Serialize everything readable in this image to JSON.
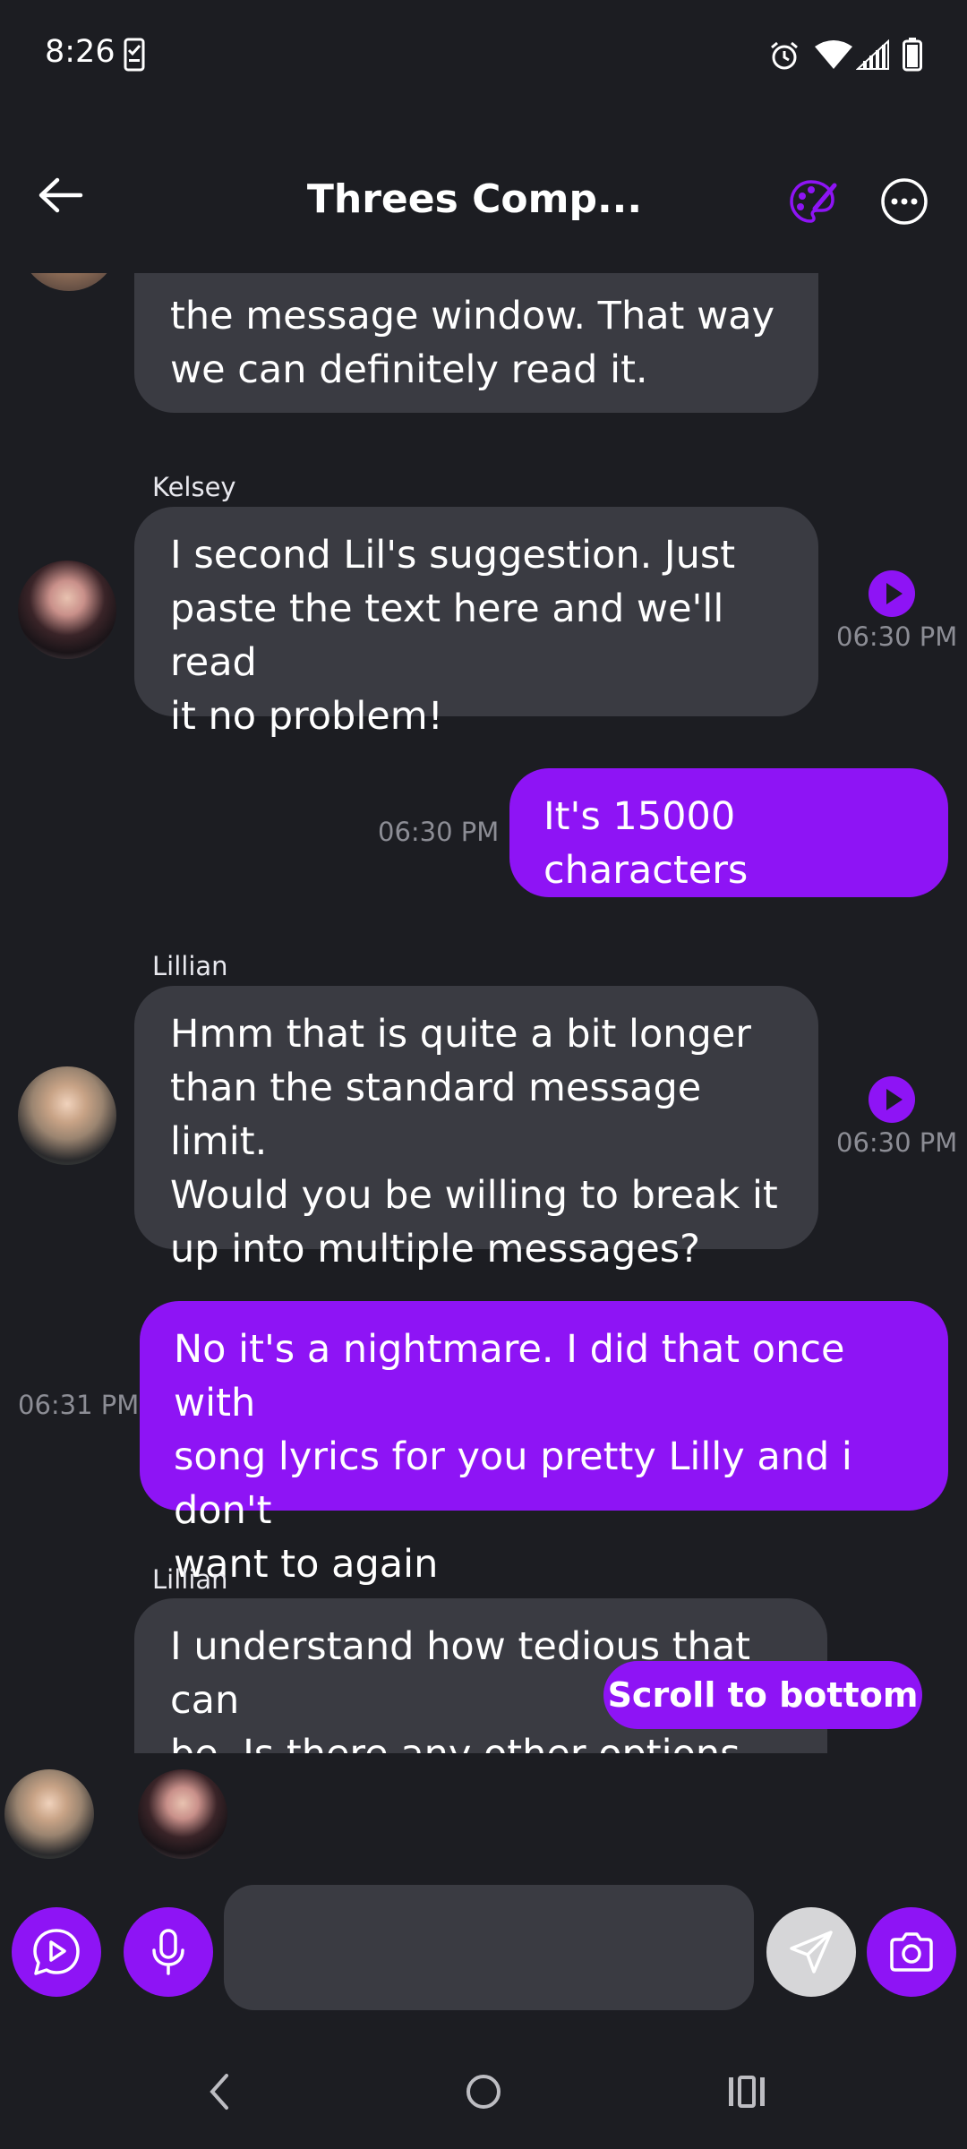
{
  "status_bar": {
    "time": "8:26"
  },
  "header": {
    "title": "Threes Comp..."
  },
  "messages": [
    {
      "side": "in",
      "sender": "",
      "text": "the message window. That way\nwe can definitely read it."
    },
    {
      "side": "in",
      "sender": "Kelsey",
      "text": "I second Lil's suggestion. Just\npaste the text here and we'll read\nit no problem!",
      "time": "06:30 PM"
    },
    {
      "side": "out",
      "text": "It's 15000 characters",
      "time": "06:30 PM"
    },
    {
      "side": "in",
      "sender": "Lillian",
      "text": "Hmm that is quite a bit longer\nthan the standard message limit.\nWould you be willing to break it\nup into multiple messages?",
      "time": "06:30 PM"
    },
    {
      "side": "out",
      "text": "No it's a nightmare. I did that once with\nsong lyrics for you pretty Lilly and i don't\nwant to again",
      "time": "06:31 PM"
    },
    {
      "side": "in",
      "sender": "Lillian",
      "text": "I understand how tedious that can\nbe. Is there any other options\nbesides Google Docs? Have you"
    }
  ],
  "scroll_to_bottom_label": "Scroll to bottom",
  "composer": {
    "placeholder": ""
  },
  "colors": {
    "accent": "#8e14f5",
    "bubble_in": "#3a3b42",
    "background": "#1c1d22"
  }
}
